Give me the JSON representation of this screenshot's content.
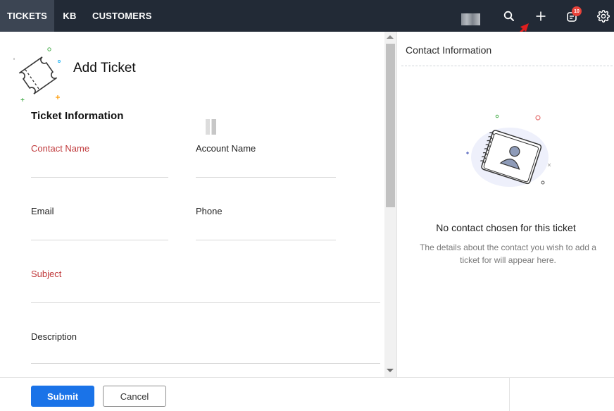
{
  "nav": {
    "tabs": [
      {
        "label": "TICKETS",
        "active": true
      },
      {
        "label": "KB",
        "active": false
      },
      {
        "label": "CUSTOMERS",
        "active": false
      }
    ],
    "icons": [
      "search-icon",
      "plus-icon",
      "notification-icon",
      "settings-icon"
    ],
    "notification_count": "10"
  },
  "form": {
    "title": "Add Ticket",
    "section_title": "Ticket Information",
    "fields": {
      "contact_name": {
        "label": "Contact Name",
        "value": "",
        "required": true
      },
      "account_name": {
        "label": "Account Name",
        "value": "",
        "required": false
      },
      "email": {
        "label": "Email",
        "value": "",
        "required": false
      },
      "phone": {
        "label": "Phone",
        "value": "",
        "required": false
      },
      "subject": {
        "label": "Subject",
        "value": "",
        "required": true
      },
      "description": {
        "label": "Description",
        "value": "",
        "required": false
      }
    }
  },
  "contact_panel": {
    "title": "Contact Information",
    "empty_title": "No contact chosen for this ticket",
    "empty_desc": "The details about the contact you wish to add a ticket for will appear here."
  },
  "footer": {
    "submit_label": "Submit",
    "cancel_label": "Cancel"
  },
  "colors": {
    "topbar": "#222a36",
    "active_tab": "#3c4553",
    "primary": "#1a73e8",
    "required_label": "#c0393b",
    "badge": "#e8433a"
  }
}
